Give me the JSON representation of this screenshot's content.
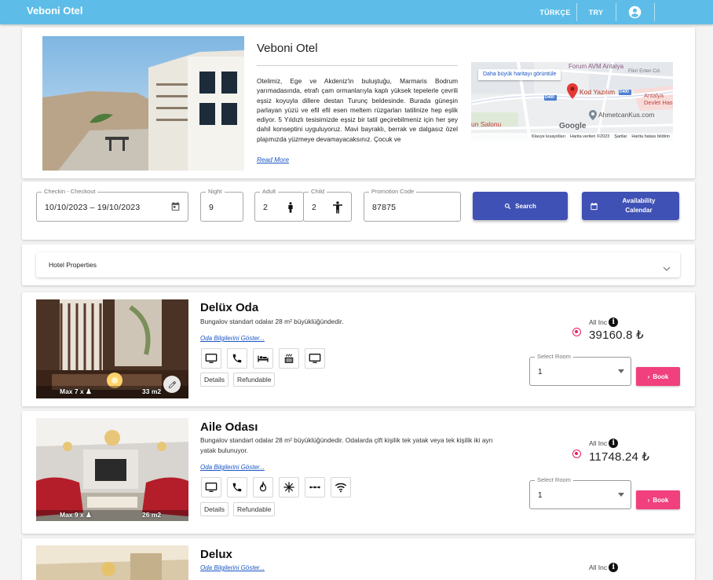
{
  "app": {
    "brand": "Veboni Otel",
    "language": "TÜRKÇE",
    "currency": "TRY"
  },
  "hotel": {
    "name": "Veboni Otel",
    "description": "Otelimiz, Ege ve Akdeniz'in buluştuğu, Marmaris Bodrum yarımadasında, etrafı çam ormanlarıyla kaplı yüksek tepelerle çevrili eşsiz koyuyla dillere destan Turunç beldesinde. Burada güneşin parlayan yüzü ve efil efil esen meltem rüzgarları tatilinize hep eşlik ediyor. 5 Yıldızlı tesisimizde eşsiz bir tatil geçirebilmeniz için her şey dahil konseptini uyguluyoruz. Mavi bayraklı, berrak ve dalgasız özel plajımızda yüzmeye devamayacaksınız. Çocuk ve",
    "read_more": "Read More"
  },
  "map": {
    "larger_map_link": "Daha büyük haritayı görüntüle",
    "places": [
      "Forum AVM Antalya",
      "Kod Yazılım",
      "AhmetcanKus.com",
      "Antalya Devlet Has",
      "Fikri Erten Cd.",
      "un Salonu",
      "D400",
      "D400"
    ],
    "footer": [
      "Klavye kısayolları",
      "Harita verileri ©2023",
      "Şartlar",
      "Harita hatası bildirin"
    ],
    "google": "Google"
  },
  "search": {
    "checkin_label": "Checkin - Checkout",
    "checkin_value": "10/10/2023 – 19/10/2023",
    "night_label": "Night",
    "night_value": "9",
    "adult_label": "Adult",
    "adult_value": "2",
    "child_label": "Child",
    "child_value": "2",
    "promo_label": "Promotion Code",
    "promo_value": "87875",
    "search_button": "Search",
    "availability_button_line1": "Availability",
    "availability_button_line2": "Calendar"
  },
  "properties": {
    "title": "Hotel Properties"
  },
  "rooms": [
    {
      "title": "Delüx Oda",
      "description": "Bungalov standart odalar 28 m² büyüklüğündedir.",
      "info_link": "Oda Bilgilerini Göster...",
      "capacity": "Max 7 x",
      "size": "33 m2",
      "amenities": [
        "tv-icon",
        "phone-icon",
        "bed-icon",
        "heater-icon",
        "monitor-icon"
      ],
      "chips": [
        "Details",
        "Refundable"
      ],
      "board": "All Inc",
      "price": "39160.8 ₺",
      "select_label": "Select Room",
      "select_value": "1",
      "book_label": "Book"
    },
    {
      "title": "Aile Odası",
      "description": "Bungalov standart odalar 28 m² büyüklüğündedir. Odalarda çift kişilik tek yatak veya tek kişilik iki ayrı yatak bulunuyor.",
      "info_link": "Oda Bilgilerini Göster...",
      "capacity": "Max 9 x",
      "size": "26 m2",
      "amenities": [
        "tv-icon",
        "phone-icon",
        "fire-icon",
        "ac-icon",
        "more-icon",
        "wifi-icon"
      ],
      "chips": [
        "Details",
        "Refundable"
      ],
      "board": "All Inc",
      "price": "11748.24 ₺",
      "select_label": "Select Room",
      "select_value": "1",
      "book_label": "Book"
    },
    {
      "title": "Delux",
      "info_link": "Oda Bilgilerini Göster...",
      "board": "All Inc"
    }
  ],
  "colors": {
    "topbar": "#5dbde8",
    "primary": "#3f51b5",
    "accent": "#e91e63",
    "book": "#f0407d"
  }
}
